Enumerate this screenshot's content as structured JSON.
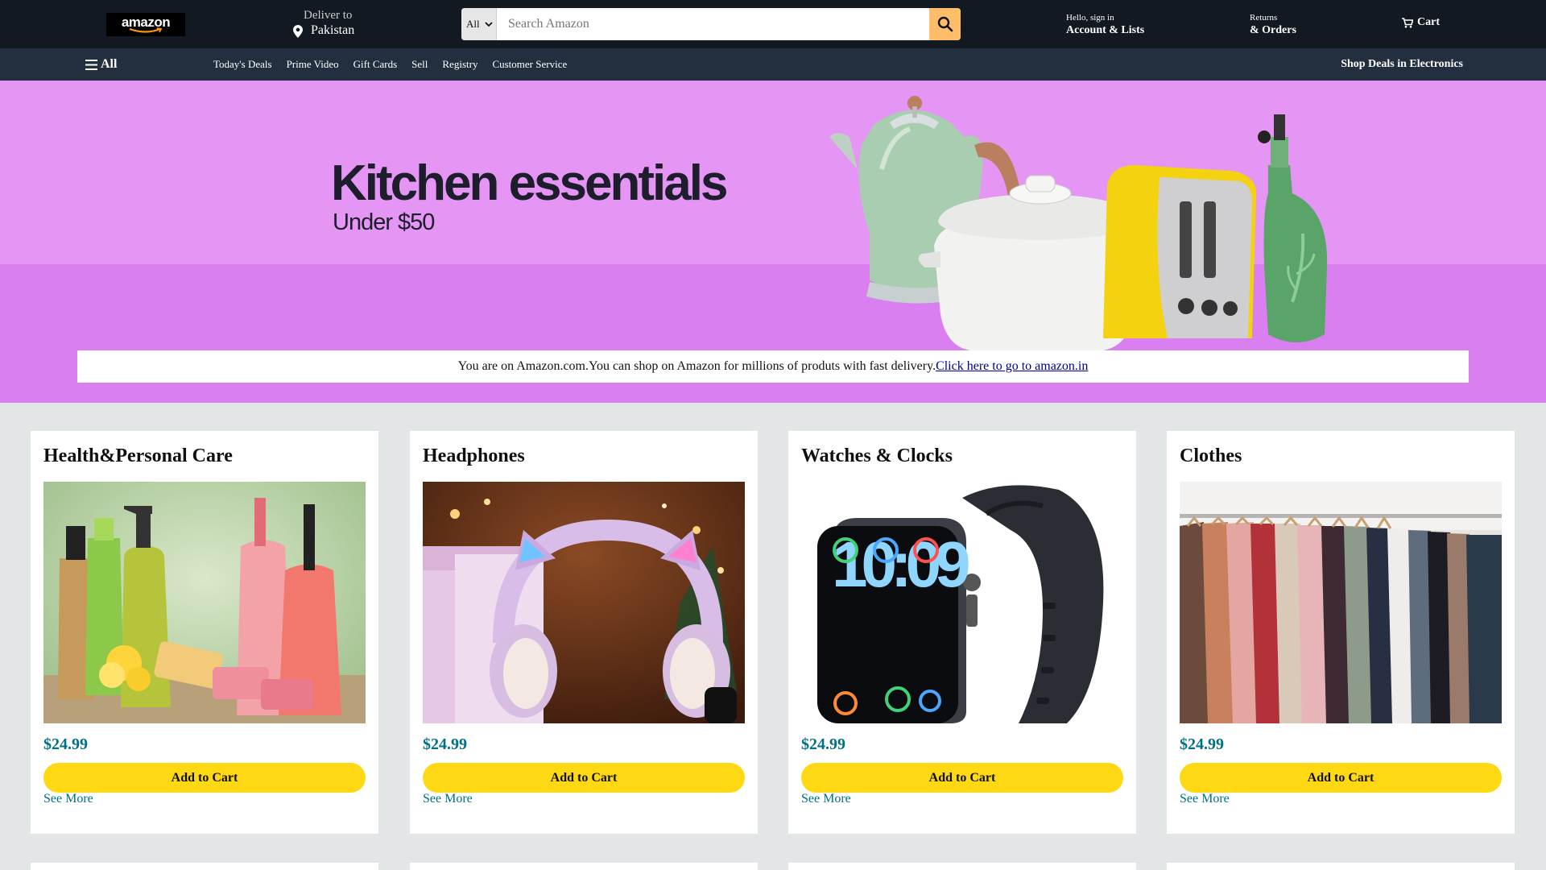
{
  "nav": {
    "logo_text": "amazon",
    "deliver_to": "Deliver to",
    "location": "Pakistan",
    "search_category": "All",
    "search_placeholder": "Search Amazon",
    "account_line1": "Hello, sign in",
    "account_line2": "Account & Lists",
    "returns_line1": "Returns",
    "returns_line2": "& Orders",
    "cart_label": "Cart"
  },
  "subnav": {
    "all_label": "All",
    "links": [
      "Today's Deals",
      "Prime Video",
      "Gift Cards",
      "Sell",
      "Registry",
      "Customer Service"
    ],
    "promo": "Shop Deals in Electronics"
  },
  "hero": {
    "title": "Kitchen essentials",
    "subtitle": "Under $50",
    "background": "#e596f5"
  },
  "notice": {
    "text": "You are on Amazon.com.You can shop on Amazon for millions of produts with fast delivery.",
    "link": "Click here to go to amazon.in"
  },
  "cards": [
    {
      "title": "Health&Personal Care",
      "price": "$24.99",
      "button": "Add to Cart",
      "more": "See More",
      "image": "personal-care-bottles"
    },
    {
      "title": "Headphones",
      "price": "$24.99",
      "button": "Add to Cart",
      "more": "See More",
      "image": "cat-ear-headphones"
    },
    {
      "title": "Watches & Clocks",
      "price": "$24.99",
      "button": "Add to Cart",
      "more": "See More",
      "image": "smartwatch"
    },
    {
      "title": "Clothes",
      "price": "$24.99",
      "button": "Add to Cart",
      "more": "See More",
      "image": "clothing-rack"
    }
  ],
  "colors": {
    "nav_bg": "#131921",
    "subnav_bg": "#232f3e",
    "search_btn": "#febd69",
    "cart_btn": "#ffd814",
    "price": "#007185",
    "page_bg": "#e3e6e6"
  }
}
